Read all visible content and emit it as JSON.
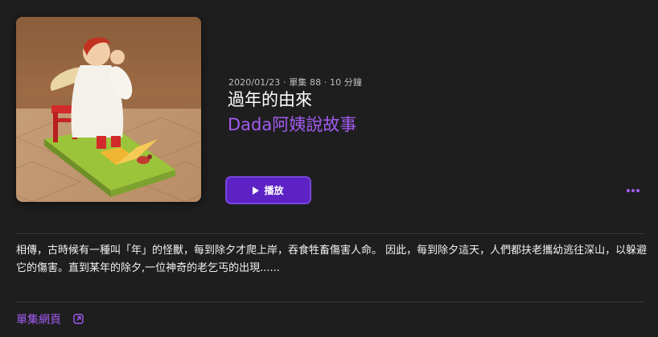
{
  "episode": {
    "meta": "2020/01/23 · 單集 88 · 10 分鐘",
    "title": "過年的由來",
    "show": "Dada阿姨說故事",
    "play_label": "播放",
    "more_icon": "ellipsis-icon",
    "description": "相傳，古時候有一種叫「年」的怪獸，每到除夕才爬上岸，吞食牲畜傷害人命。 因此，每到除夕這天，人們都扶老攜幼逃往深山，以躲避它的傷害。直到某年的除夕,一位神奇的老乞丐的出現......",
    "link_label": "單集網頁",
    "link_icon": "external-link-icon"
  },
  "colors": {
    "background": "#1e1e1f",
    "accent": "#a25cf0",
    "play_button": "#5c22c4",
    "text": "#ffffff",
    "meta_text": "#bdbdc2"
  }
}
